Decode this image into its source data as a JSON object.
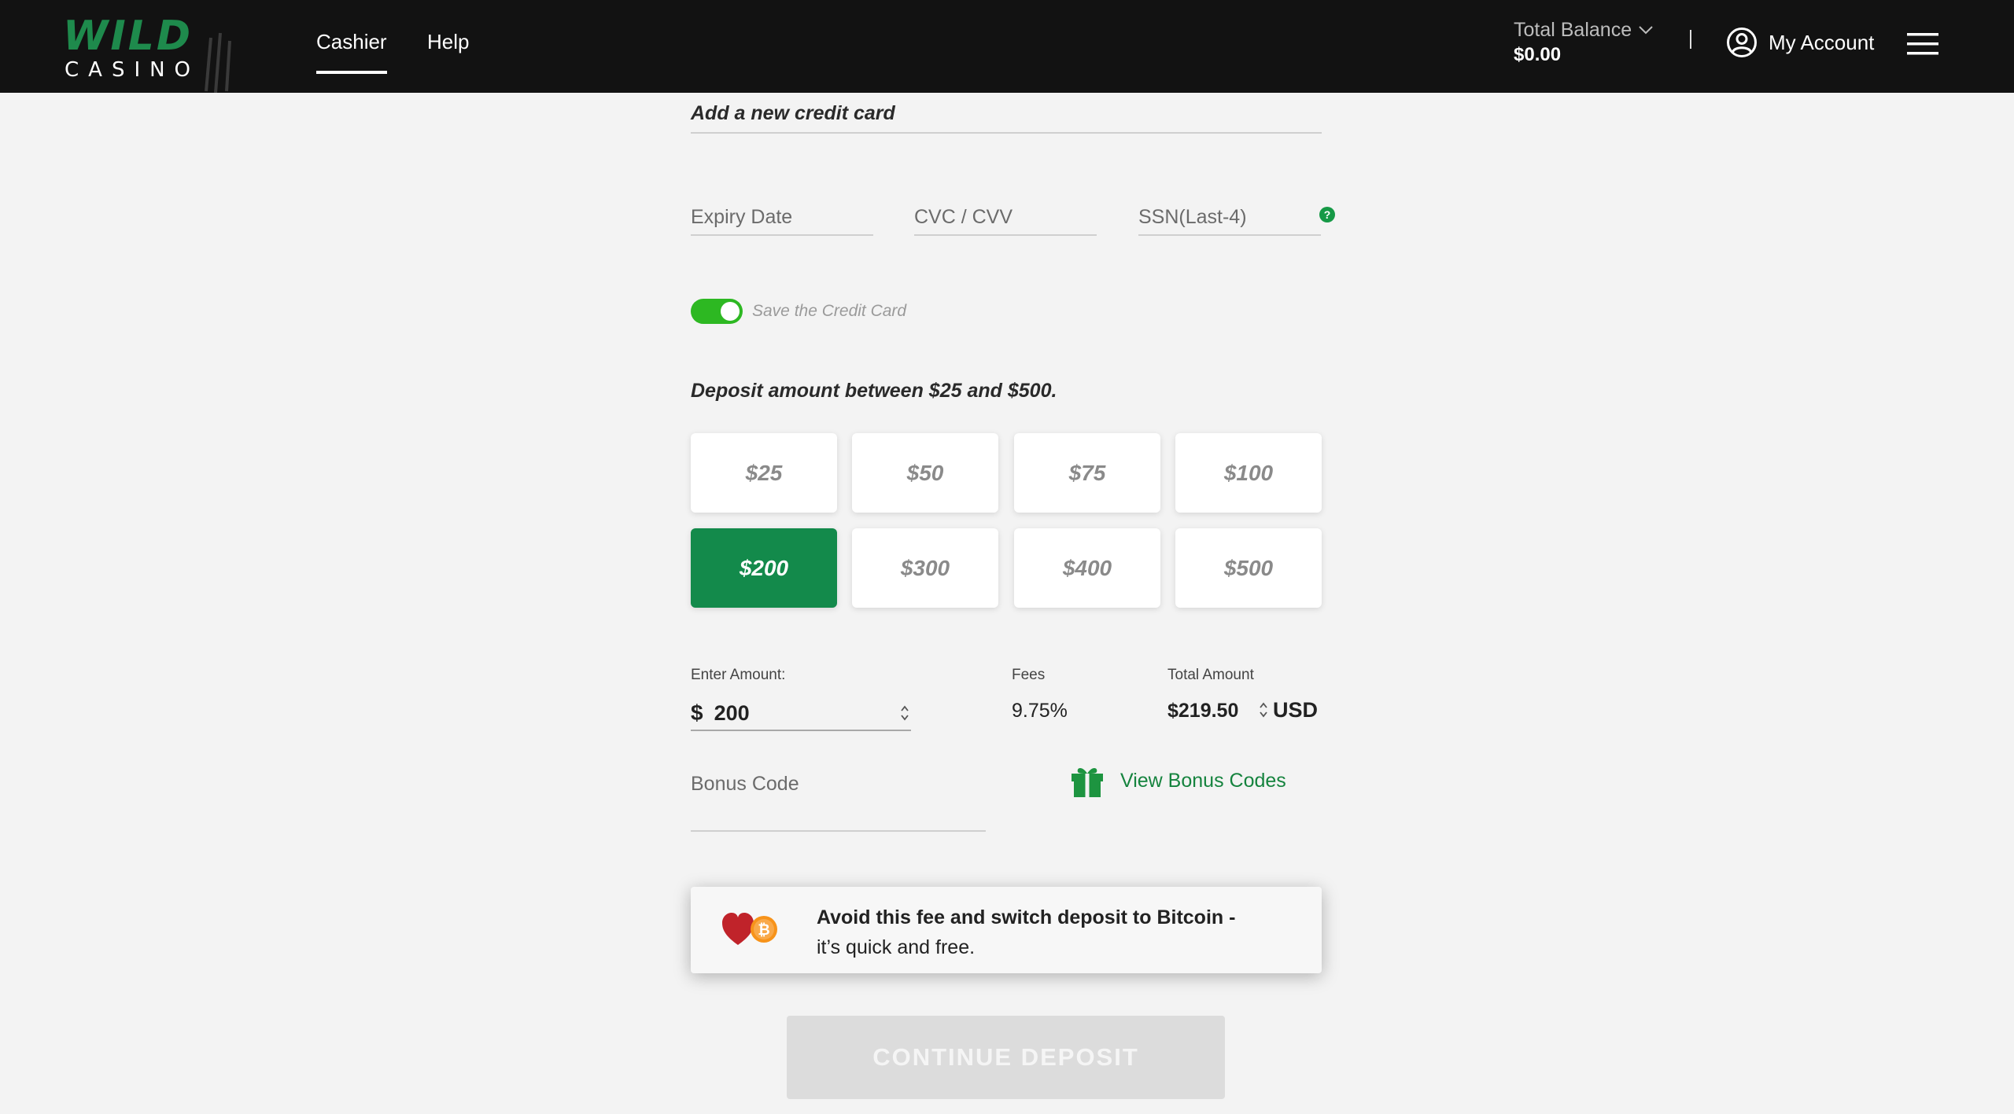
{
  "header": {
    "logo": {
      "line1": "WILD",
      "line2": "CASINO"
    },
    "nav": [
      {
        "label": "Cashier",
        "active": true
      },
      {
        "label": "Help",
        "active": false
      }
    ],
    "balance": {
      "label": "Total Balance",
      "value": "$0.00"
    },
    "divider": "|",
    "account_label": "My Account"
  },
  "form": {
    "card_header": "Add a new credit card",
    "fields": {
      "expiry_placeholder": "Expiry Date",
      "cvc_placeholder": "CVC / CVV",
      "ssn_placeholder": "SSN(Last-4)",
      "help_glyph": "?"
    },
    "save_card": {
      "label": "Save the Credit Card",
      "on": true
    },
    "deposit_range": "Deposit amount between $25 and $500.",
    "amounts": [
      "$25",
      "$50",
      "$75",
      "$100",
      "$200",
      "$300",
      "$400",
      "$500"
    ],
    "selected_amount": "$200",
    "enter_amount": {
      "label": "Enter Amount:",
      "currency_symbol": "$",
      "value": "200"
    },
    "fees": {
      "label": "Fees",
      "value": "9.75%"
    },
    "total": {
      "label": "Total Amount",
      "value": "$219.50",
      "currency": "USD"
    },
    "bonus": {
      "placeholder": "Bonus Code",
      "view_link": "View Bonus Codes"
    },
    "bitcoin_banner": {
      "line1": "Avoid this fee and switch deposit to Bitcoin -",
      "line2": "it’s quick and free."
    },
    "continue_label": "CONTINUE DEPOSIT"
  },
  "colors": {
    "brand_green": "#138a4b",
    "toggle_green": "#2db822",
    "link_green": "#15833e",
    "header_bg": "#121212",
    "page_bg": "#f3f3f3"
  },
  "icons": [
    "claw-marks-icon",
    "chevron-down-icon",
    "user-circle-icon",
    "hamburger-menu-icon",
    "help-icon",
    "stepper-icon",
    "gift-icon",
    "heart-bitcoin-icon"
  ]
}
